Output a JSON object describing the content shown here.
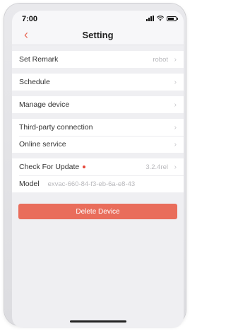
{
  "status_bar": {
    "time": "7:00"
  },
  "nav": {
    "back_glyph": "‹",
    "title": "Setting"
  },
  "groups": [
    {
      "rows": [
        {
          "label": "Set Remark",
          "value": "robot"
        }
      ]
    },
    {
      "rows": [
        {
          "label": "Schedule"
        }
      ]
    },
    {
      "rows": [
        {
          "label": "Manage device"
        }
      ]
    },
    {
      "rows": [
        {
          "label": "Third-party connection"
        },
        {
          "label": "Online service"
        }
      ]
    },
    {
      "rows": [
        {
          "label": "Check For Update",
          "value": "3.2.4rel"
        },
        {
          "label": "Model",
          "value": "exvac-660-84-f3-eb-6a-e8-43"
        }
      ]
    }
  ],
  "chevron": "›",
  "delete_button": "Delete Device",
  "colors": {
    "accent": "#e96d5b",
    "update_dot": "#e5483b",
    "background": "#efeff2"
  }
}
